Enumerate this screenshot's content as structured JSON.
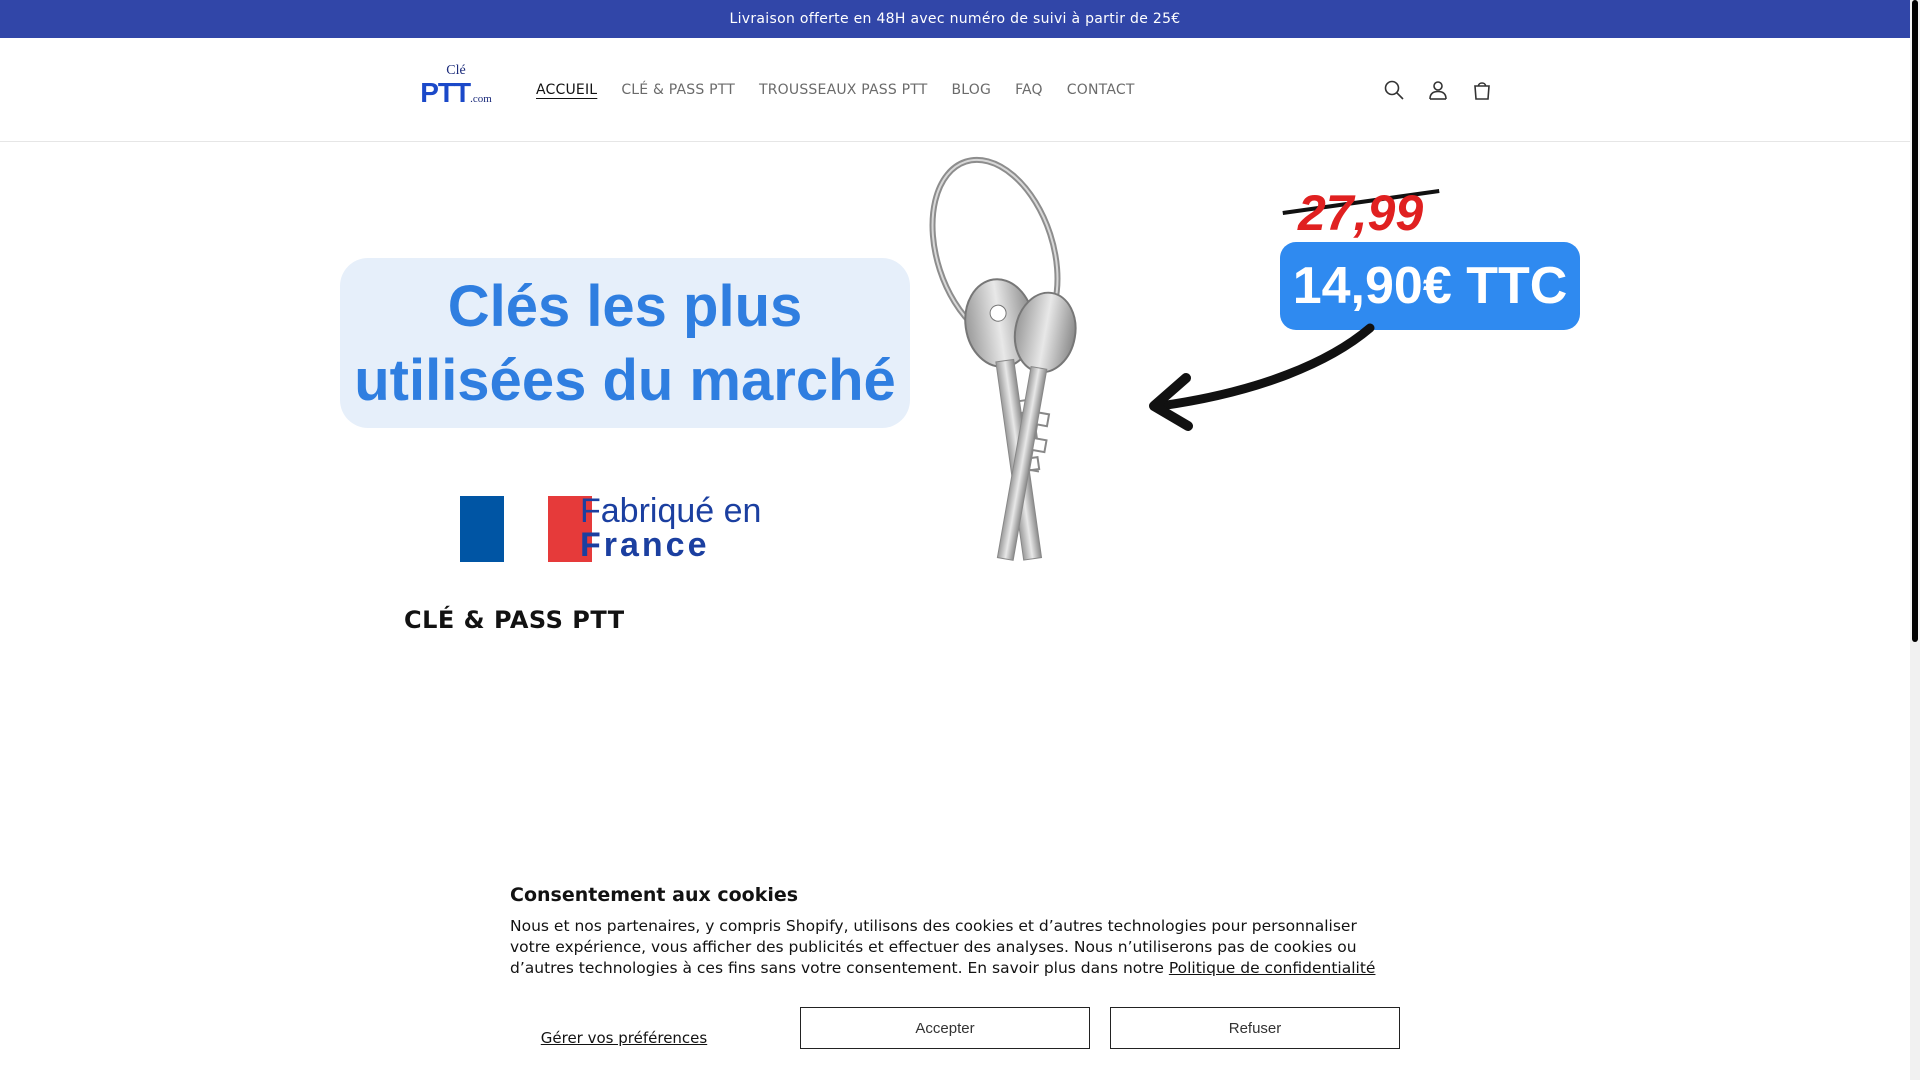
{
  "announcement": {
    "text": "Livraison offerte en 48H avec numéro de suivi à partir de 25€"
  },
  "logo": {
    "top": "Clé",
    "main": "PTT",
    "suffix": ".com"
  },
  "nav": {
    "items": [
      {
        "label": "ACCUEIL",
        "active": true
      },
      {
        "label": "CLÉ & PASS PTT",
        "active": false
      },
      {
        "label": "TROUSSEAUX PASS PTT",
        "active": false
      },
      {
        "label": "BLOG",
        "active": false
      },
      {
        "label": "FAQ",
        "active": false
      },
      {
        "label": "CONTACT",
        "active": false
      }
    ]
  },
  "header_icons": [
    "search-icon",
    "account-icon",
    "cart-icon"
  ],
  "banner": {
    "headline_line1": "Clés les plus",
    "headline_line2": "utilisées du marché",
    "old_price": "27,99",
    "new_price": "14,90€ TTC",
    "made_in_line1": "Fabriqué en",
    "made_in_line2": "France",
    "colors": {
      "blue_text": "#2f7ee0",
      "badge": "#2f8af0",
      "old_price": "#e02020",
      "flag_blue": "#0055a4",
      "flag_red": "#e63a3a"
    }
  },
  "collection": {
    "title": "CLÉ & PASS PTT"
  },
  "cookie": {
    "title": "Consentement aux cookies",
    "body": "Nous et nos partenaires, y compris Shopify, utilisons des cookies et d’autres technologies pour personnaliser votre expérience, vous afficher des publicités et effectuer des analyses. Nous n’utiliserons pas de cookies ou d’autres technologies à ces fins sans votre consentement. En savoir plus dans notre ",
    "policy_link": "Politique de confidentialité",
    "manage_label": "Gérer vos préférences",
    "accept_label": "Accepter",
    "decline_label": "Refuser"
  },
  "theme": {
    "announcement_bg": "#3146a8"
  }
}
